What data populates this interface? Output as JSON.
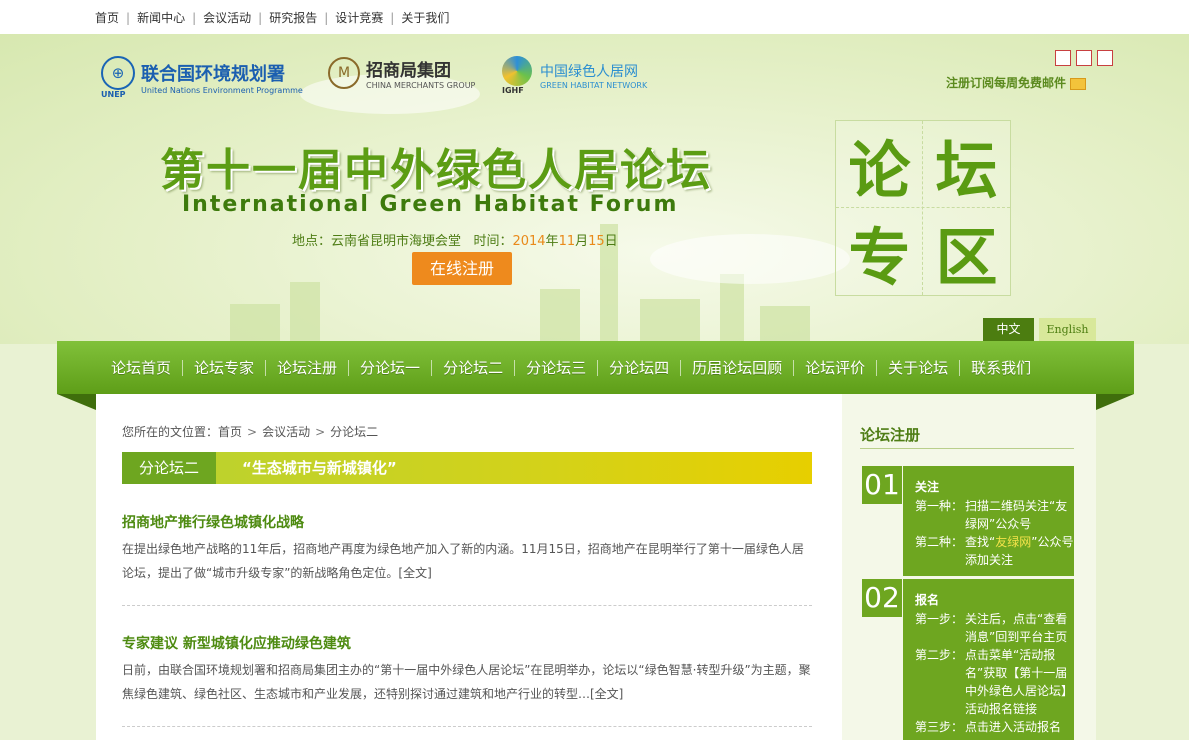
{
  "top_nav": {
    "items": [
      "首页",
      "新闻中心",
      "会议活动",
      "研究报告",
      "设计竞赛",
      "关于我们"
    ]
  },
  "header": {
    "logos": {
      "unep_cn": "联合国环境规划署",
      "unep_en": "United Nations Environment Programme",
      "unep_abbr": "UNEP",
      "cm_cn": "招商局集团",
      "cm_en": "CHINA MERCHANTS GROUP",
      "ghn_cn": "中国绿色人居网",
      "ghn_en": "GREEN HABITAT NETWORK",
      "ghn_abbr": "IGHF"
    },
    "subscribe": "注册订阅每周免费邮件",
    "title_cn": "第十一届中外绿色人居论坛",
    "title_en": "International Green Habitat Forum",
    "info": {
      "place_label": "地点：",
      "place": "云南省昆明市海埂会堂",
      "time_label": "时间：",
      "year": "2014",
      "year_unit": "年",
      "month": "11",
      "month_unit": "月",
      "day": "15",
      "day_unit": "日"
    },
    "register_button": "在线注册",
    "calligraphy": [
      "论",
      "坛",
      "专",
      "区"
    ],
    "lang_cn": "中文",
    "lang_en": "English"
  },
  "main_nav": {
    "items": [
      "论坛首页",
      "论坛专家",
      "论坛注册",
      "分论坛一",
      "分论坛二",
      "分论坛三",
      "分论坛四",
      "历届论坛回顾",
      "论坛评价",
      "关于论坛",
      "联系我们"
    ]
  },
  "breadcrumb": {
    "prefix": "您所在的文位置：",
    "items": [
      "首页",
      "会议活动",
      "分论坛二"
    ],
    "separator": ">"
  },
  "section": {
    "tab": "分论坛二",
    "topic": "“生态城市与新城镇化”"
  },
  "articles": [
    {
      "title": "招商地产推行绿色城镇化战略",
      "summary": "在提出绿色地产战略的11年后，招商地产再度为绿色地产加入了新的内涵。11月15日，招商地产在昆明举行了第十一届绿色人居论坛，提出了做“城市升级专家”的新战略角色定位。[全文]"
    },
    {
      "title": "专家建议 新型城镇化应推动绿色建筑",
      "summary": "日前，由联合国环境规划署和招商局集团主办的“第十一届中外绿色人居论坛”在昆明举办，论坛以“绿色智慧·转型升级”为主题，聚焦绿色建筑、绿色社区、生态城市和产业发展，还特别探讨通过建筑和地产行业的转型…[全文]"
    }
  ],
  "sidebar": {
    "title": "论坛注册",
    "steps": [
      {
        "num": "01",
        "title": "关注",
        "rows": [
          {
            "label": "第一种：",
            "value": "扫描二维码关注“友绿网”公众号"
          },
          {
            "label": "第二种：",
            "value_pre": "查找“",
            "value_hl": "友绿网",
            "value_post": "”公众号添加关注"
          }
        ]
      },
      {
        "num": "02",
        "title": "报名",
        "rows": [
          {
            "label": "第一步：",
            "value": "关注后，点击“查看消息”回到平台主页"
          },
          {
            "label": "第二步：",
            "value": "点击菜单“活动报名”获取【第十一届中外绿色人居论坛】活动报名链接"
          },
          {
            "label": "第三步：",
            "value": "点击进入活动报名"
          }
        ]
      }
    ]
  },
  "colors": {
    "brand_green": "#6ea620",
    "title_green": "#4e8b11",
    "accent_orange": "#ee8a1d",
    "banner_yellow": "#e7cf00"
  }
}
